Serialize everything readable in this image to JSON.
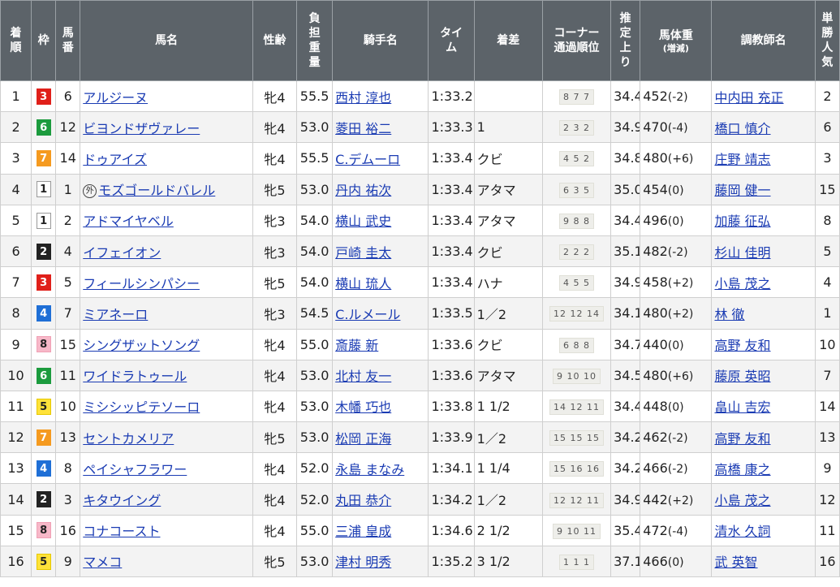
{
  "headers": {
    "rank": "着順",
    "frame": "枠",
    "horse_no": "馬番",
    "horse_name": "馬名",
    "sex_age": "性齢",
    "weight_carried": "負担重量",
    "jockey": "騎手名",
    "time": "タイム",
    "margin": "着差",
    "corner_line1": "コーナー",
    "corner_line2": "通過順位",
    "last3f": "推定上り",
    "body_weight": "馬体重",
    "body_weight_sub": "(増減)",
    "trainer": "調教師名",
    "popularity": "単勝人気"
  },
  "frame_colors": {
    "1": {
      "bg": "#ffffff",
      "fg": "#222222",
      "border": "#999999"
    },
    "2": {
      "bg": "#222222",
      "fg": "#ffffff",
      "border": "#222222"
    },
    "3": {
      "bg": "#e0201a",
      "fg": "#ffffff",
      "border": "#e0201a"
    },
    "4": {
      "bg": "#1f6fd6",
      "fg": "#ffffff",
      "border": "#1f6fd6"
    },
    "5": {
      "bg": "#ffe23a",
      "fg": "#222222",
      "border": "#e6c800"
    },
    "6": {
      "bg": "#1c9b3e",
      "fg": "#ffffff",
      "border": "#1c9b3e"
    },
    "7": {
      "bg": "#f59a1f",
      "fg": "#ffffff",
      "border": "#f59a1f"
    },
    "8": {
      "bg": "#f7b8c8",
      "fg": "#222222",
      "border": "#f0a0b5"
    }
  },
  "rows": [
    {
      "rank": "1",
      "frame": "3",
      "num": "6",
      "name": "アルジーヌ",
      "foreign": "",
      "sexage": "牝4",
      "wt": "55.5",
      "jockey": "西村 淳也",
      "time": "1:33.2",
      "margin": "",
      "corner": "8 7 7",
      "last3f": "34.4",
      "bw": "452",
      "bwchg": "(-2)",
      "trainer": "中内田 充正",
      "pop": "2"
    },
    {
      "rank": "2",
      "frame": "6",
      "num": "12",
      "name": "ビヨンドザヴァレー",
      "foreign": "",
      "sexage": "牝4",
      "wt": "53.0",
      "jockey": "菱田 裕二",
      "time": "1:33.3",
      "margin": "1",
      "corner": "2 3 2",
      "last3f": "34.9",
      "bw": "470",
      "bwchg": "(-4)",
      "trainer": "橋口 慎介",
      "pop": "6"
    },
    {
      "rank": "3",
      "frame": "7",
      "num": "14",
      "name": "ドゥアイズ",
      "foreign": "",
      "sexage": "牝4",
      "wt": "55.5",
      "jockey": "C.デムーロ",
      "time": "1:33.4",
      "margin": "クビ",
      "corner": "4 5 2",
      "last3f": "34.8",
      "bw": "480",
      "bwchg": "(+6)",
      "trainer": "庄野 靖志",
      "pop": "3"
    },
    {
      "rank": "4",
      "frame": "1",
      "num": "1",
      "name": "モズゴールドバレル",
      "foreign": "外",
      "sexage": "牝5",
      "wt": "53.0",
      "jockey": "丹内 祐次",
      "time": "1:33.4",
      "margin": "アタマ",
      "corner": "6 3 5",
      "last3f": "35.0",
      "bw": "454",
      "bwchg": "(0)",
      "trainer": "藤岡 健一",
      "pop": "15"
    },
    {
      "rank": "5",
      "frame": "1",
      "num": "2",
      "name": "アドマイヤベル",
      "foreign": "",
      "sexage": "牝3",
      "wt": "54.0",
      "jockey": "横山 武史",
      "time": "1:33.4",
      "margin": "アタマ",
      "corner": "9 8 8",
      "last3f": "34.4",
      "bw": "496",
      "bwchg": "(0)",
      "trainer": "加藤 征弘",
      "pop": "8"
    },
    {
      "rank": "6",
      "frame": "2",
      "num": "4",
      "name": "イフェイオン",
      "foreign": "",
      "sexage": "牝3",
      "wt": "54.0",
      "jockey": "戸崎 圭太",
      "time": "1:33.4",
      "margin": "クビ",
      "corner": "2 2 2",
      "last3f": "35.1",
      "bw": "482",
      "bwchg": "(-2)",
      "trainer": "杉山 佳明",
      "pop": "5"
    },
    {
      "rank": "7",
      "frame": "3",
      "num": "5",
      "name": "フィールシンパシー",
      "foreign": "",
      "sexage": "牝5",
      "wt": "54.0",
      "jockey": "横山 琉人",
      "time": "1:33.4",
      "margin": "ハナ",
      "corner": "4 5 5",
      "last3f": "34.9",
      "bw": "458",
      "bwchg": "(+2)",
      "trainer": "小島 茂之",
      "pop": "4"
    },
    {
      "rank": "8",
      "frame": "4",
      "num": "7",
      "name": "ミアネーロ",
      "foreign": "",
      "sexage": "牝3",
      "wt": "54.5",
      "jockey": "C.ルメール",
      "time": "1:33.5",
      "margin": "1／2",
      "corner": "12 12 14",
      "last3f": "34.1",
      "bw": "480",
      "bwchg": "(+2)",
      "trainer": "林 徹",
      "pop": "1"
    },
    {
      "rank": "9",
      "frame": "8",
      "num": "15",
      "name": "シングザットソング",
      "foreign": "",
      "sexage": "牝4",
      "wt": "55.0",
      "jockey": "斎藤 新",
      "time": "1:33.6",
      "margin": "クビ",
      "corner": "6 8 8",
      "last3f": "34.7",
      "bw": "440",
      "bwchg": "(0)",
      "trainer": "高野 友和",
      "pop": "10"
    },
    {
      "rank": "10",
      "frame": "6",
      "num": "11",
      "name": "ワイドラトゥール",
      "foreign": "",
      "sexage": "牝4",
      "wt": "53.0",
      "jockey": "北村 友一",
      "time": "1:33.6",
      "margin": "アタマ",
      "corner": "9 10 10",
      "last3f": "34.5",
      "bw": "480",
      "bwchg": "(+6)",
      "trainer": "藤原 英昭",
      "pop": "7"
    },
    {
      "rank": "11",
      "frame": "5",
      "num": "10",
      "name": "ミシシッピテソーロ",
      "foreign": "",
      "sexage": "牝4",
      "wt": "53.0",
      "jockey": "木幡 巧也",
      "time": "1:33.8",
      "margin": "1 1/2",
      "corner": "14 12 11",
      "last3f": "34.4",
      "bw": "448",
      "bwchg": "(0)",
      "trainer": "畠山 吉宏",
      "pop": "14"
    },
    {
      "rank": "12",
      "frame": "7",
      "num": "13",
      "name": "セントカメリア",
      "foreign": "",
      "sexage": "牝5",
      "wt": "53.0",
      "jockey": "松岡 正海",
      "time": "1:33.9",
      "margin": "1／2",
      "corner": "15 15 15",
      "last3f": "34.2",
      "bw": "462",
      "bwchg": "(-2)",
      "trainer": "高野 友和",
      "pop": "13"
    },
    {
      "rank": "13",
      "frame": "4",
      "num": "8",
      "name": "ペイシャフラワー",
      "foreign": "",
      "sexage": "牝4",
      "wt": "52.0",
      "jockey": "永島 まなみ",
      "time": "1:34.1",
      "margin": "1 1/4",
      "corner": "15 16 16",
      "last3f": "34.2",
      "bw": "466",
      "bwchg": "(-2)",
      "trainer": "高橋 康之",
      "pop": "9"
    },
    {
      "rank": "14",
      "frame": "2",
      "num": "3",
      "name": "キタウイング",
      "foreign": "",
      "sexage": "牝4",
      "wt": "52.0",
      "jockey": "丸田 恭介",
      "time": "1:34.2",
      "margin": "1／2",
      "corner": "12 12 11",
      "last3f": "34.9",
      "bw": "442",
      "bwchg": "(+2)",
      "trainer": "小島 茂之",
      "pop": "12"
    },
    {
      "rank": "15",
      "frame": "8",
      "num": "16",
      "name": "コナコースト",
      "foreign": "",
      "sexage": "牝4",
      "wt": "55.0",
      "jockey": "三浦 皇成",
      "time": "1:34.6",
      "margin": "2 1/2",
      "corner": "9 10 11",
      "last3f": "35.4",
      "bw": "472",
      "bwchg": "(-4)",
      "trainer": "清水 久詞",
      "pop": "11"
    },
    {
      "rank": "16",
      "frame": "5",
      "num": "9",
      "name": "マメコ",
      "foreign": "",
      "sexage": "牝5",
      "wt": "53.0",
      "jockey": "津村 明秀",
      "time": "1:35.2",
      "margin": "3 1/2",
      "corner": "1 1 1",
      "last3f": "37.1",
      "bw": "466",
      "bwchg": "(0)",
      "trainer": "武 英智",
      "pop": "16"
    }
  ]
}
